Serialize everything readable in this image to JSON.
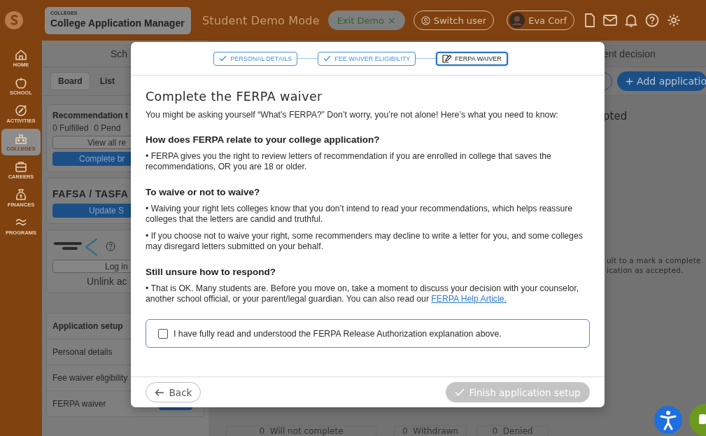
{
  "top_bar": {
    "section_label": "COLLEGES",
    "title": "College Application Manager",
    "mode_label": "Student Demo Mode",
    "exit_demo": {
      "label": "Exit Demo",
      "close_glyph": "×"
    },
    "switch_user": {
      "label": "Switch user"
    },
    "user": {
      "name": "Eva Corf"
    }
  },
  "sidebar": {
    "items": [
      {
        "label": "HOME",
        "selected": false
      },
      {
        "label": "SCHOOL",
        "selected": false
      },
      {
        "label": "ACTIVITIES",
        "selected": false
      },
      {
        "label": "COLLEGES",
        "selected": true
      },
      {
        "label": "CAREERS",
        "selected": false
      },
      {
        "label": "FINANCES",
        "selected": false
      },
      {
        "label": "PROGRAMS",
        "selected": false
      }
    ]
  },
  "left_panel": {
    "heading": "Sch",
    "view_tabs": [
      {
        "label": "Board",
        "selected": true
      },
      {
        "label": "List",
        "selected": false
      }
    ],
    "recommendation_card": {
      "title": "Recommendation t",
      "counts": [
        "0 Fulfilled",
        "0 Pend"
      ],
      "outline_button": "View all re",
      "primary_button": "Complete br"
    },
    "fafsa_card": {
      "title": "FAFSA / TASFA",
      "primary_button": "Update S"
    },
    "common_app_card": {
      "outline_button": "Log in",
      "link": "Unlink ac"
    },
    "setup_card": {
      "title": "Application setup",
      "rows": [
        "Personal details",
        "Fee waiver eligibility",
        "FERPA waiver"
      ]
    }
  },
  "main": {
    "heading": "ent decision",
    "add_button": "Add applicatio",
    "column_title": "pted",
    "hint_lines": [
      "ult to a mark a complete",
      "ication as accepted."
    ],
    "status_counts": [
      {
        "value": "0",
        "label": "Will not complete"
      },
      {
        "value": "0",
        "label": "Withdrawn"
      },
      {
        "value": "0",
        "label": "Denied"
      }
    ]
  },
  "modal": {
    "steps": [
      {
        "label": "PERSONAL DETAILS",
        "completed": true,
        "selected": false
      },
      {
        "label": "FEE WAIVER ELIGIBILITY",
        "completed": true,
        "selected": false
      },
      {
        "label": "FERPA WAIVER",
        "completed": false,
        "selected": true
      }
    ],
    "title": "Complete the FERPA waiver",
    "intro": "You might be asking yourself “What's FERPA?” Don’t worry, you’re not alone! Here’s what you need to know:",
    "sections": [
      {
        "heading": "How does FERPA relate to your college application?",
        "bullets": [
          {
            "text": "•  FERPA gives you the right to review letters of recommendation if you are enrolled in college that saves the recommendations, OR you are 18 or older."
          }
        ]
      },
      {
        "heading": "To waive or not to waive?",
        "bullets": [
          {
            "text": "•  Waiving your right lets colleges know that you don’t intend to read your recommendations, which helps reassure colleges that the letters are candid and truthful."
          },
          {
            "text": "•  If you choose not to waive your right, some recommenders may decline to write a letter for you, and some colleges may disregard letters submitted on your behalf."
          }
        ]
      },
      {
        "heading": "Still unsure how to respond?",
        "bullets": [
          {
            "text": "•  That is OK. Many students are. Before you move on, take a moment to discuss your decision with your counselor, another school official, or your parent/legal guardian. You can also read our",
            "link": "FERPA Help Article."
          }
        ]
      }
    ],
    "consent": {
      "label": "I have fully read and understood the FERPA Release Authorization explanation above.",
      "checked": false
    },
    "back_button": "Back",
    "finish_button": {
      "label": "Finish application setup",
      "disabled": true
    }
  }
}
